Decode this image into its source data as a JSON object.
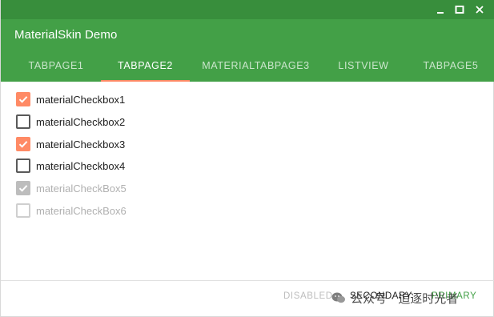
{
  "window": {
    "title": "MaterialSkin Demo",
    "controls": [
      "minimize-icon",
      "maximize-icon",
      "close-icon"
    ]
  },
  "tabs": [
    {
      "label": "TABPAGE1",
      "active": false
    },
    {
      "label": "TABPAGE2",
      "active": true
    },
    {
      "label": "MATERIALTABPAGE3",
      "active": false
    },
    {
      "label": "LISTVIEW",
      "active": false
    },
    {
      "label": "TABPAGE5",
      "active": false
    }
  ],
  "checkboxes": [
    {
      "label": "materialCheckbox1",
      "checked": true,
      "enabled": true
    },
    {
      "label": "materialCheckbox2",
      "checked": false,
      "enabled": true
    },
    {
      "label": "materialCheckbox3",
      "checked": true,
      "enabled": true
    },
    {
      "label": "materialCheckbox4",
      "checked": false,
      "enabled": true
    },
    {
      "label": "materialCheckBox5",
      "checked": true,
      "enabled": false
    },
    {
      "label": "materialCheckBox6",
      "checked": false,
      "enabled": false
    }
  ],
  "footer": {
    "disabled_label": "DISABLED",
    "secondary_label": "SECONDARY",
    "primary_label": "PRIMARY",
    "watermark_text": "公众号 · 追逐时光者"
  },
  "colors": {
    "titlebar": "#388e3c",
    "header": "#43a047",
    "accent": "#ff8a65",
    "disabled": "#bdbdbd"
  }
}
